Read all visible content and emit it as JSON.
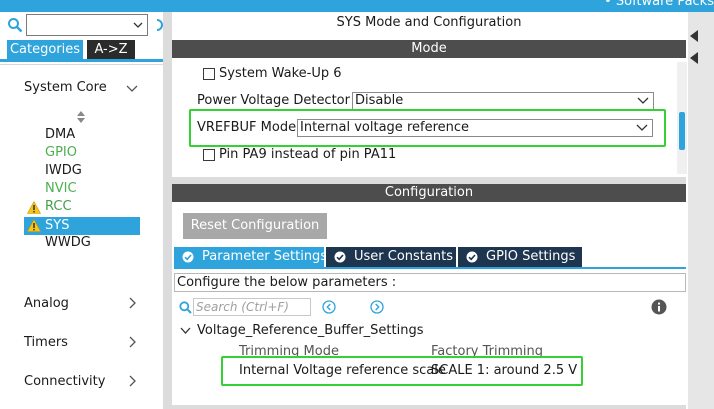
{
  "top_bar": {
    "packs_label": "• Software Packs"
  },
  "left_panel": {
    "search": {
      "value": ""
    },
    "tabs": {
      "categories": "Categories",
      "az": "A->Z"
    },
    "sections": {
      "system_core": "System Core",
      "analog": "Analog",
      "timers": "Timers",
      "connectivity": "Connectivity"
    },
    "items": {
      "dma": "DMA",
      "gpio": "GPIO",
      "iwdg": "IWDG",
      "nvic": "NVIC",
      "rcc": "RCC",
      "sys": "SYS",
      "wwdg": "WWDG"
    }
  },
  "mode_panel": {
    "title": "SYS Mode and Configuration",
    "header": "Mode",
    "wakeup6": {
      "label": "System Wake-Up 6",
      "checked": false
    },
    "pvd": {
      "label": "Power Voltage Detector In",
      "value": "Disable"
    },
    "vrefbuf": {
      "label": "VREFBUF Mode",
      "value": "Internal voltage reference"
    },
    "pa9": {
      "label": "Pin PA9 instead of pin PA11",
      "checked": false
    }
  },
  "config_panel": {
    "header": "Configuration",
    "reset_button": "Reset Configuration",
    "tabs": {
      "parameter": "Parameter Settings",
      "user_constants": "User Constants",
      "gpio": "GPIO Settings"
    },
    "caption": "Configure the below parameters :",
    "search_placeholder": "Search (Ctrl+F)",
    "group": "Voltage_Reference_Buffer_Settings",
    "params": {
      "trimming_mode_label": "Trimming Mode",
      "trimming_mode_value": "Factory Trimming",
      "scale_label": "Internal Voltage reference scale",
      "scale_value": "SCALE 1: around 2.5 V"
    }
  },
  "colors": {
    "accent": "#2fa4dc",
    "dark_header": "#4d4d4d",
    "highlight": "#35d035",
    "warning": "#f5c518",
    "enabled_item": "#4caf50"
  }
}
